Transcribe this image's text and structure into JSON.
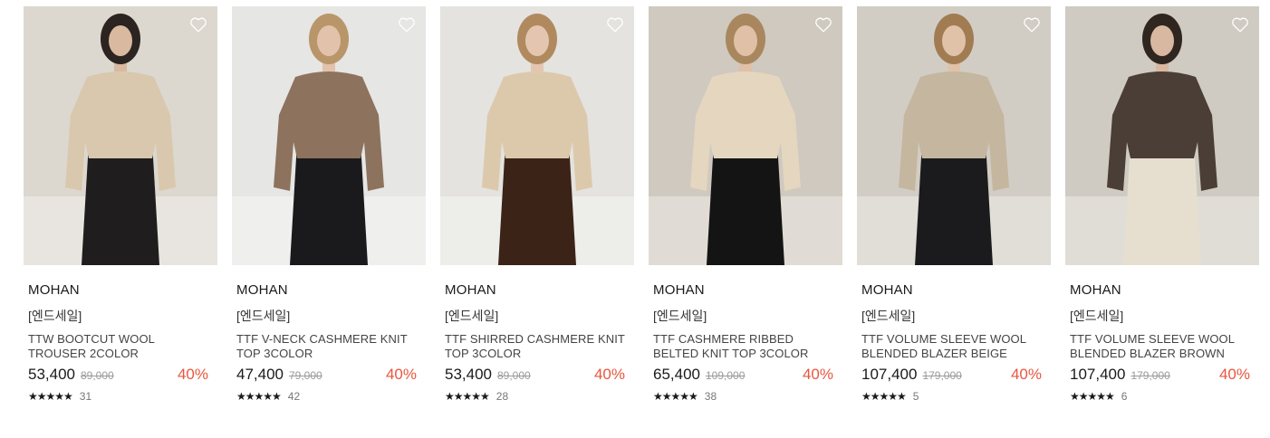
{
  "products": [
    {
      "brand": "MOHAN",
      "tag": "[엔드세일]",
      "name": "TTW BOOTCUT WOOL TROUSER 2COLOR",
      "price": "53,400",
      "original_price": "89,000",
      "discount": "40%",
      "stars": "★★★★★",
      "rating": 5.0,
      "review_count": "31",
      "colors": {
        "bg": "#dcd8cf",
        "top": "#d9c8ad",
        "bottom": "#1f1d1d",
        "hair": "#2b2420",
        "skin": "#d9b9a0"
      }
    },
    {
      "brand": "MOHAN",
      "tag": "[엔드세일]",
      "name": "TTF V-NECK CASHMERE KNIT TOP 3COLOR",
      "price": "47,400",
      "original_price": "79,000",
      "discount": "40%",
      "stars": "★★★★★",
      "rating": 4.5,
      "review_count": "42",
      "colors": {
        "bg": "#e6e6e4",
        "top": "#8d725e",
        "bottom": "#1a1a1c",
        "hair": "#b8966a",
        "skin": "#e2c2ab"
      }
    },
    {
      "brand": "MOHAN",
      "tag": "[엔드세일]",
      "name": "TTF SHIRRED CASHMERE KNIT TOP 3COLOR",
      "price": "53,400",
      "original_price": "89,000",
      "discount": "40%",
      "stars": "★★★★★",
      "rating": 4.5,
      "review_count": "28",
      "colors": {
        "bg": "#e4e3df",
        "top": "#dcc9ac",
        "bottom": "#3b2318",
        "hair": "#b08a5e",
        "skin": "#e4c6b0"
      }
    },
    {
      "brand": "MOHAN",
      "tag": "[엔드세일]",
      "name": "TTF CASHMERE RIBBED BELTED KNIT TOP 3COLOR",
      "price": "65,400",
      "original_price": "109,000",
      "discount": "40%",
      "stars": "★★★★★",
      "rating": 4.5,
      "review_count": "38",
      "colors": {
        "bg": "#cfc9bf",
        "top": "#e4d6bf",
        "bottom": "#141414",
        "hair": "#a9875e",
        "skin": "#e0c0a6"
      }
    },
    {
      "brand": "MOHAN",
      "tag": "[엔드세일]",
      "name": "TTF VOLUME SLEEVE WOOL BLENDED BLAZER BEIGE",
      "price": "107,400",
      "original_price": "179,000",
      "discount": "40%",
      "stars": "★★★★★",
      "rating": 4.5,
      "review_count": "5",
      "colors": {
        "bg": "#d2cdc4",
        "top": "#c5b6a0",
        "bottom": "#1b1b1d",
        "hair": "#a17c52",
        "skin": "#e0c2a9"
      }
    },
    {
      "brand": "MOHAN",
      "tag": "[엔드세일]",
      "name": "TTF VOLUME SLEEVE WOOL BLENDED BLAZER BROWN",
      "price": "107,400",
      "original_price": "179,000",
      "discount": "40%",
      "stars": "★★★★★",
      "rating": 5.0,
      "review_count": "6",
      "colors": {
        "bg": "#d0cbc2",
        "top": "#4a3e36",
        "bottom": "#e6dfcf",
        "hair": "#2f2620",
        "skin": "#d8b8a0"
      }
    }
  ],
  "icons": {
    "wishlist": "heart-outline-icon",
    "rating": "star-icon"
  },
  "accent_color": "#e8563f"
}
